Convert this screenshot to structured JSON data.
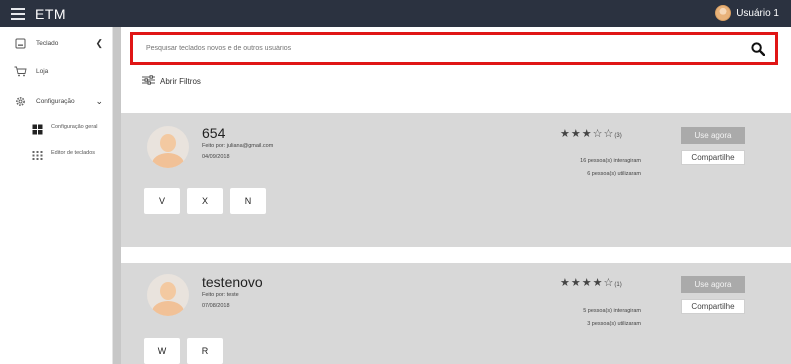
{
  "app": {
    "title": "ETM",
    "user": "Usuário 1"
  },
  "sidebar": {
    "items": [
      {
        "label": "Teclado",
        "icon": "keyboard-icon"
      },
      {
        "label": "Loja",
        "icon": "cart-icon"
      },
      {
        "label": "Configuração",
        "icon": "gear-icon"
      }
    ],
    "subitems": [
      {
        "label": "Configuração geral",
        "icon": "grid-icon"
      },
      {
        "label": "Editor de teclados",
        "icon": "keypad-icon"
      }
    ]
  },
  "search": {
    "placeholder": "Pesquisar teclados novos e de outros usuários",
    "value": ""
  },
  "filters": {
    "label": "Abrir Filtros"
  },
  "cards": [
    {
      "title": "654",
      "author": "Feito por: juliana@gmail.com",
      "date": "04/09/2018",
      "rating": 3,
      "rating_count": "(3)",
      "interacted": "16 pessoa(s) interagiram",
      "used": "6 pessoa(s) utilizaram",
      "use_label": "Use agora",
      "share_label": "Compartilhe",
      "keys": [
        "V",
        "X",
        "N"
      ]
    },
    {
      "title": "testenovo",
      "author": "Feito por: teste",
      "date": "07/08/2018",
      "rating": 4,
      "rating_count": "(1)",
      "interacted": "5 pessoa(s) interagiram",
      "used": "3 pessoa(s) utilizaram",
      "use_label": "Use agora",
      "share_label": "Compartilhe",
      "keys": [
        "W",
        "R"
      ]
    }
  ],
  "colors": {
    "topbar": "#2b3240",
    "highlight": "#e01515",
    "card_bg": "#d8d8d8",
    "use_button": "#aaaaaa"
  }
}
